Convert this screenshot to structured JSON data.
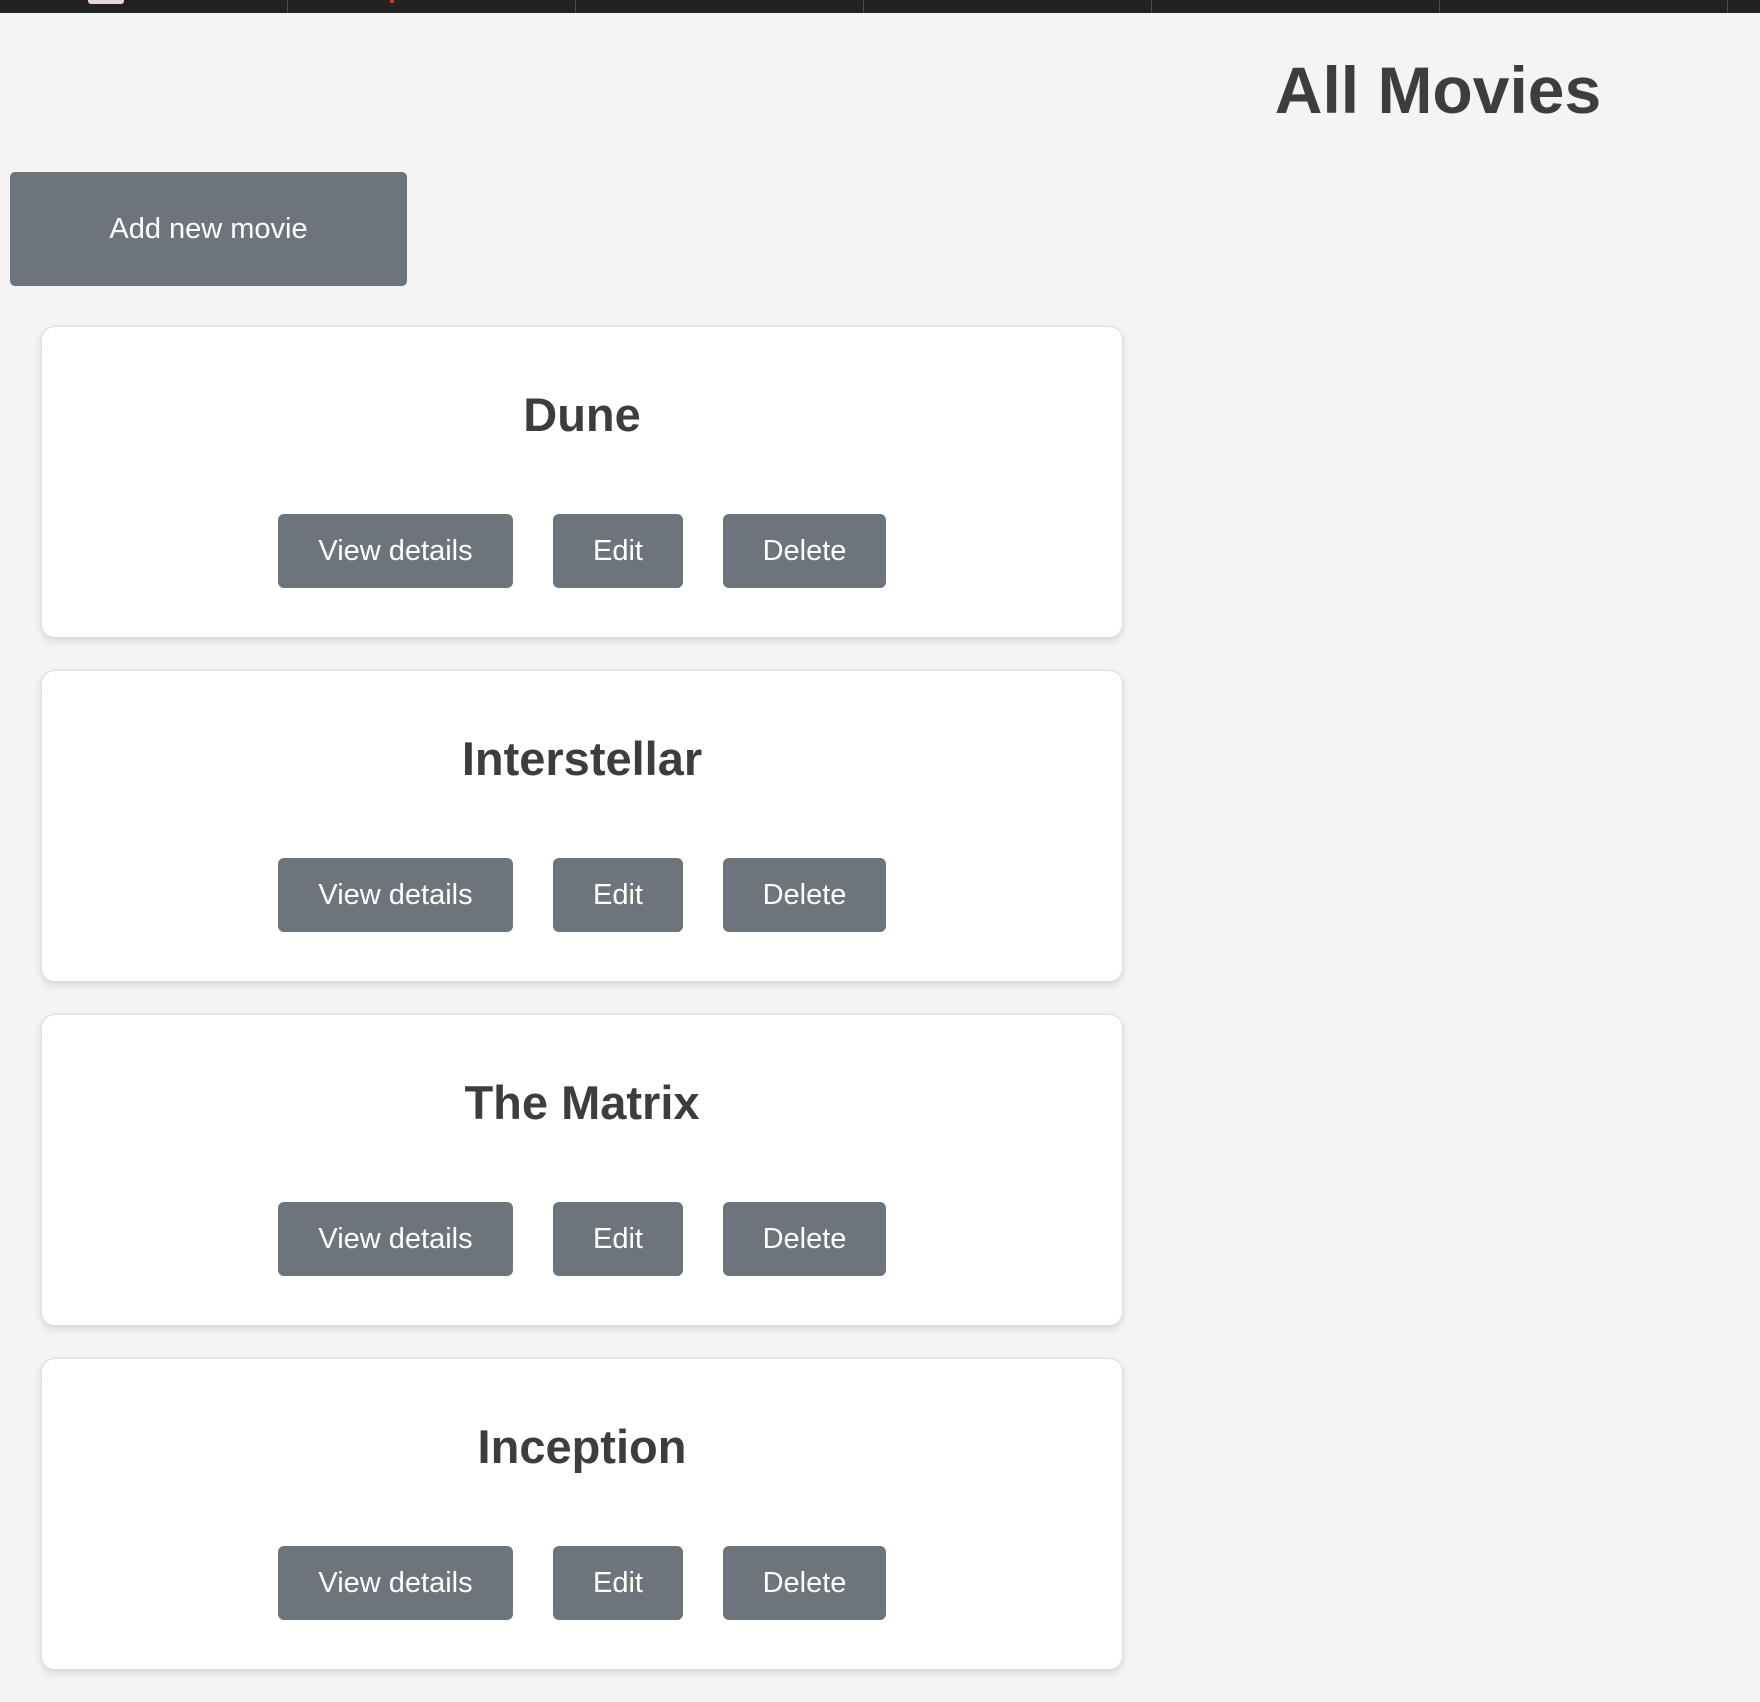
{
  "header": {
    "title": "All Movies"
  },
  "toolbar": {
    "add_label": "Add new movie"
  },
  "movies": [
    {
      "title": "Dune",
      "view_label": "View details",
      "edit_label": "Edit",
      "delete_label": "Delete"
    },
    {
      "title": "Interstellar",
      "view_label": "View details",
      "edit_label": "Edit",
      "delete_label": "Delete"
    },
    {
      "title": "The Matrix",
      "view_label": "View details",
      "edit_label": "Edit",
      "delete_label": "Delete"
    },
    {
      "title": "Inception",
      "view_label": "View details",
      "edit_label": "Edit",
      "delete_label": "Delete"
    }
  ],
  "colors": {
    "background": "#f4f4f4",
    "button": "#6d747c",
    "text": "#3d3d3d",
    "card": "#ffffff"
  }
}
